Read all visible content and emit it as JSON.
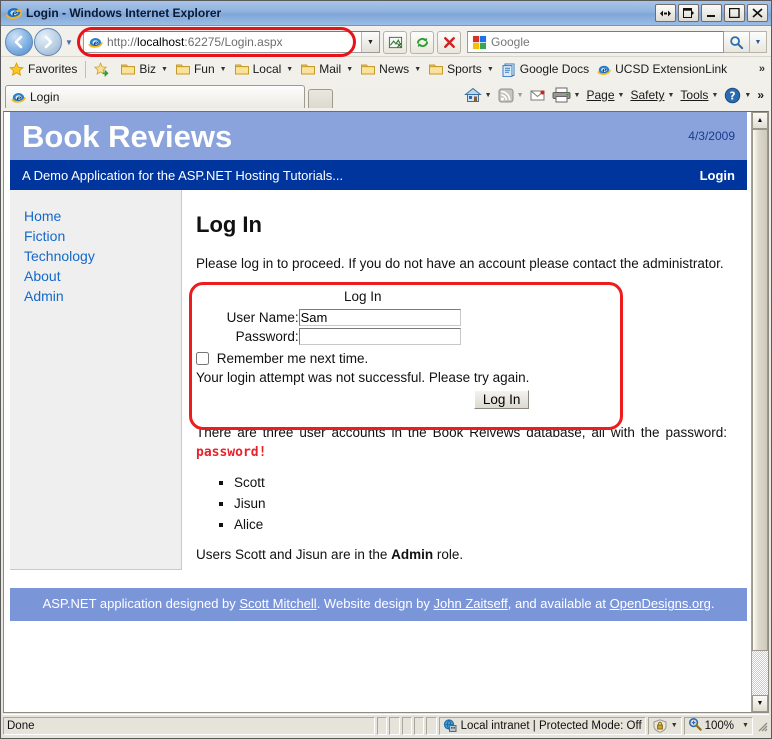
{
  "window": {
    "title": "Login - Windows Internet Explorer",
    "icon": "ie-logo-icon",
    "buttons": [
      {
        "name": "restore-down-button",
        "glyph": "⬌"
      },
      {
        "name": "full-screen-button",
        "glyph": "◨"
      },
      {
        "name": "minimize-button",
        "glyph": "–"
      },
      {
        "name": "maximize-button",
        "glyph": "□"
      },
      {
        "name": "close-button",
        "glyph": "✕"
      }
    ]
  },
  "navbar": {
    "back_glyph": "←",
    "forward_glyph": "→",
    "history_glyph": "▼",
    "address_prefix": "http://",
    "address_host": "localhost",
    "address_rest": ":62275/Login.aspx",
    "address_full": "http://localhost:62275/Login.aspx",
    "address_dropdown_glyph": "▼",
    "compat_button": "compatibility-view-icon",
    "refresh_glyph": "↻",
    "stop_glyph": "✕",
    "search_placeholder": "Google",
    "search_value": "",
    "search_go_glyph": "⌕",
    "search_drop_glyph": "▼"
  },
  "favorites_bar": {
    "favorites_label": "Favorites",
    "add_button": "add-to-favorites-bar-icon",
    "items": [
      {
        "label": "Biz",
        "icon": "folder-icon",
        "dropdown": true
      },
      {
        "label": "Fun",
        "icon": "folder-icon",
        "dropdown": true
      },
      {
        "label": "Local",
        "icon": "folder-icon",
        "dropdown": true
      },
      {
        "label": "Mail",
        "icon": "folder-icon",
        "dropdown": true
      },
      {
        "label": "News",
        "icon": "folder-icon",
        "dropdown": true
      },
      {
        "label": "Sports",
        "icon": "folder-icon",
        "dropdown": true
      },
      {
        "label": "Google Docs",
        "icon": "google-docs-icon",
        "dropdown": false
      },
      {
        "label": "UCSD ExtensionLink",
        "icon": "ie-logo-icon",
        "dropdown": false
      }
    ],
    "overflow_glyph": "»"
  },
  "tabs": {
    "items": [
      {
        "label": "Login",
        "icon": "ie-logo-icon"
      }
    ],
    "new_tab_name": "new-tab-button"
  },
  "command_bar": {
    "home_icon": "home-icon",
    "feeds_icon": "rss-feed-icon",
    "read_mail_icon": "mail-icon",
    "print_icon": "printer-icon",
    "items": [
      {
        "label": "Page",
        "accesskey": "P"
      },
      {
        "label": "Safety",
        "accesskey": "S"
      },
      {
        "label": "Tools",
        "accesskey": "o"
      }
    ],
    "help_icon": "help-icon",
    "overflow_glyph": "»"
  },
  "page": {
    "header": {
      "title": "Book Reviews",
      "date": "4/3/2009",
      "tagline": "A Demo Application for the ASP.NET Hosting Tutorials...",
      "login_link": "Login"
    },
    "sidebar": {
      "items": [
        {
          "label": "Home"
        },
        {
          "label": "Fiction"
        },
        {
          "label": "Technology"
        },
        {
          "label": "About"
        },
        {
          "label": "Admin"
        }
      ]
    },
    "main": {
      "heading": "Log In",
      "intro": "Please log in to proceed. If you do not have an account please contact the administrator.",
      "login_form": {
        "legend": "Log In",
        "username_label": "User Name:",
        "username_value": "Sam",
        "password_label": "Password:",
        "password_value": "",
        "remember_label": "Remember me next time.",
        "remember_checked": false,
        "error_message": "Your login attempt was not successful. Please try again.",
        "submit_label": "Log In",
        "highlight_color": "#ee1c1c"
      },
      "accounts_intro_1": "There are three user accounts in the Book Reivews database, all with the password: ",
      "accounts_password": "password!",
      "accounts": [
        "Scott",
        "Jisun",
        "Alice"
      ],
      "roles_note_1": "Users Scott and Jisun are in the ",
      "roles_note_bold": "Admin",
      "roles_note_2": " role."
    },
    "footer": {
      "text_1": "ASP.NET application designed by ",
      "link_1": "Scott Mitchell",
      "text_2": ". Website design by ",
      "link_2": "John Zaitseff",
      "text_3": ", and available at ",
      "link_3": "OpenDesigns.org",
      "text_4": "."
    }
  },
  "scrollbar": {
    "up_glyph": "▲",
    "down_glyph": "▼"
  },
  "statusbar": {
    "status": "Done",
    "zone": "Local intranet | Protected Mode: Off",
    "zone_icon": "intranet-zone-icon",
    "protected_icon": "privacy-lock-icon",
    "protected_drop_glyph": "▼",
    "zoom_icon": "zoom-magnifier-icon",
    "zoom_level": "100%",
    "zoom_drop_glyph": "▼"
  },
  "colors": {
    "title_blue": "#8fb2de",
    "header_blue": "#8aa3dc",
    "subheader_blue": "#00359e",
    "footer_blue": "#7b95d9",
    "link_blue": "#1569c7",
    "error_red": "#e8222a",
    "highlight_red": "#ee1c1c"
  }
}
